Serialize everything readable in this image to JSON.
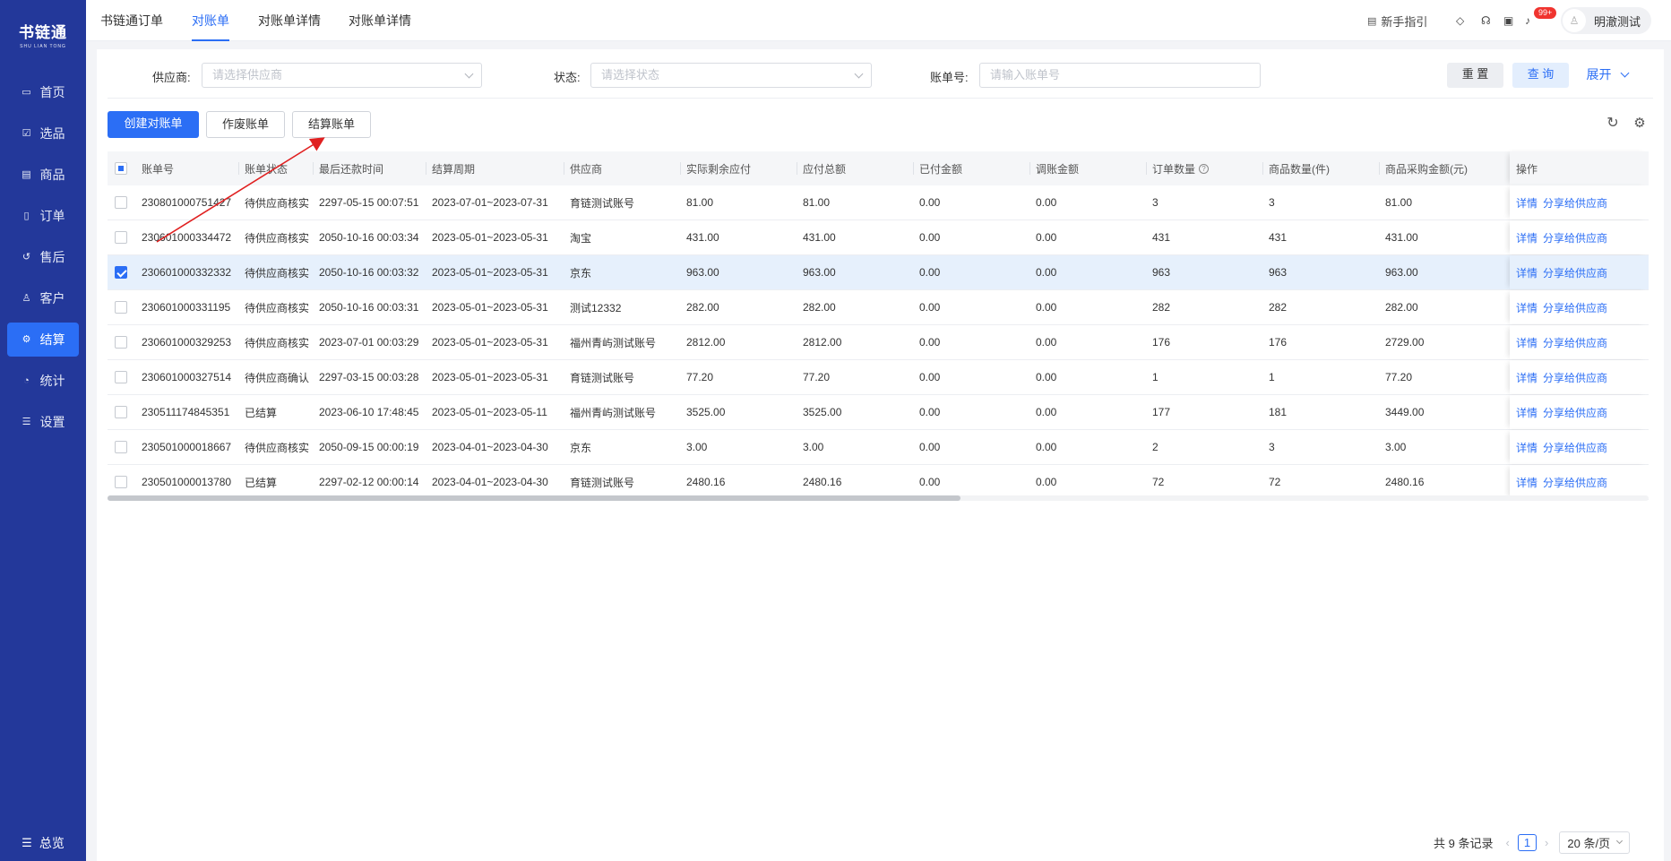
{
  "app": {
    "logo_main": "书链通",
    "logo_sub": "SHU LIAN TONG"
  },
  "sidebar": {
    "items": [
      {
        "label": "首页",
        "icon": "monitor-icon",
        "glyph": "▭"
      },
      {
        "label": "选品",
        "icon": "checklist-icon",
        "glyph": "☑"
      },
      {
        "label": "商品",
        "icon": "box-icon",
        "glyph": "▤"
      },
      {
        "label": "订单",
        "icon": "document-icon",
        "glyph": "▯"
      },
      {
        "label": "售后",
        "icon": "refresh-icon",
        "glyph": "↺"
      },
      {
        "label": "客户",
        "icon": "users-icon",
        "glyph": "♙"
      },
      {
        "label": "结算",
        "icon": "settle-icon",
        "glyph": "⚙"
      },
      {
        "label": "统计",
        "icon": "pie-chart-icon",
        "glyph": "◔"
      },
      {
        "label": "设置",
        "icon": "sliders-icon",
        "glyph": "☰"
      }
    ],
    "active_index": 6,
    "footer": "总览"
  },
  "tabs": [
    "书链通订单",
    "对账单",
    "对账单详情",
    "对账单详情"
  ],
  "active_tab": 1,
  "header": {
    "guide": "新手指引",
    "badge": "99+",
    "user": "明澈测试"
  },
  "filters": {
    "supplier_label": "供应商:",
    "supplier_placeholder": "请选择供应商",
    "status_label": "状态:",
    "status_placeholder": "请选择状态",
    "bill_label": "账单号:",
    "bill_placeholder": "请输入账单号",
    "reset": "重 置",
    "query": "查 询",
    "expand": "展开"
  },
  "toolbar": {
    "create": "创建对账单",
    "void": "作废账单",
    "settle": "结算账单"
  },
  "table": {
    "columns": [
      "账单号",
      "账单状态",
      "最后还款时间",
      "结算周期",
      "供应商",
      "实际剩余应付",
      "应付总额",
      "已付金额",
      "调账金额",
      "订单数量",
      "商品数量(件)",
      "商品采购金额(元)",
      "操作"
    ],
    "rows": [
      [
        "230801000751427",
        "待供应商核实",
        "2297-05-15 00:07:51",
        "2023-07-01~2023-07-31",
        "育链测试账号",
        "81.00",
        "81.00",
        "0.00",
        "0.00",
        "3",
        "3",
        "81.00"
      ],
      [
        "230601000334472",
        "待供应商核实",
        "2050-10-16 00:03:34",
        "2023-05-01~2023-05-31",
        "淘宝",
        "431.00",
        "431.00",
        "0.00",
        "0.00",
        "431",
        "431",
        "431.00"
      ],
      [
        "230601000332332",
        "待供应商核实",
        "2050-10-16 00:03:32",
        "2023-05-01~2023-05-31",
        "京东",
        "963.00",
        "963.00",
        "0.00",
        "0.00",
        "963",
        "963",
        "963.00"
      ],
      [
        "230601000331195",
        "待供应商核实",
        "2050-10-16 00:03:31",
        "2023-05-01~2023-05-31",
        "测试12332",
        "282.00",
        "282.00",
        "0.00",
        "0.00",
        "282",
        "282",
        "282.00"
      ],
      [
        "230601000329253",
        "待供应商核实",
        "2023-07-01 00:03:29",
        "2023-05-01~2023-05-31",
        "福州青屿测试账号",
        "2812.00",
        "2812.00",
        "0.00",
        "0.00",
        "176",
        "176",
        "2729.00"
      ],
      [
        "230601000327514",
        "待供应商确认",
        "2297-03-15 00:03:28",
        "2023-05-01~2023-05-31",
        "育链测试账号",
        "77.20",
        "77.20",
        "0.00",
        "0.00",
        "1",
        "1",
        "77.20"
      ],
      [
        "230511174845351",
        "已结算",
        "2023-06-10 17:48:45",
        "2023-05-01~2023-05-11",
        "福州青屿测试账号",
        "3525.00",
        "3525.00",
        "0.00",
        "0.00",
        "177",
        "181",
        "3449.00"
      ],
      [
        "230501000018667",
        "待供应商核实",
        "2050-09-15 00:00:19",
        "2023-04-01~2023-04-30",
        "京东",
        "3.00",
        "3.00",
        "0.00",
        "0.00",
        "2",
        "3",
        "3.00"
      ],
      [
        "230501000013780",
        "已结算",
        "2297-02-12 00:00:14",
        "2023-04-01~2023-04-30",
        "育链测试账号",
        "2480.16",
        "2480.16",
        "0.00",
        "0.00",
        "72",
        "72",
        "2480.16"
      ]
    ],
    "selected_rows": [
      2
    ],
    "op_detail": "详情",
    "op_share": "分享给供应商"
  },
  "pagination": {
    "total": "共 9 条记录",
    "current": "1",
    "page_size": "20 条/页"
  },
  "colors": {
    "sidebar": "#23389a",
    "accent": "#2b6ef5",
    "annotation": "#e02020"
  }
}
